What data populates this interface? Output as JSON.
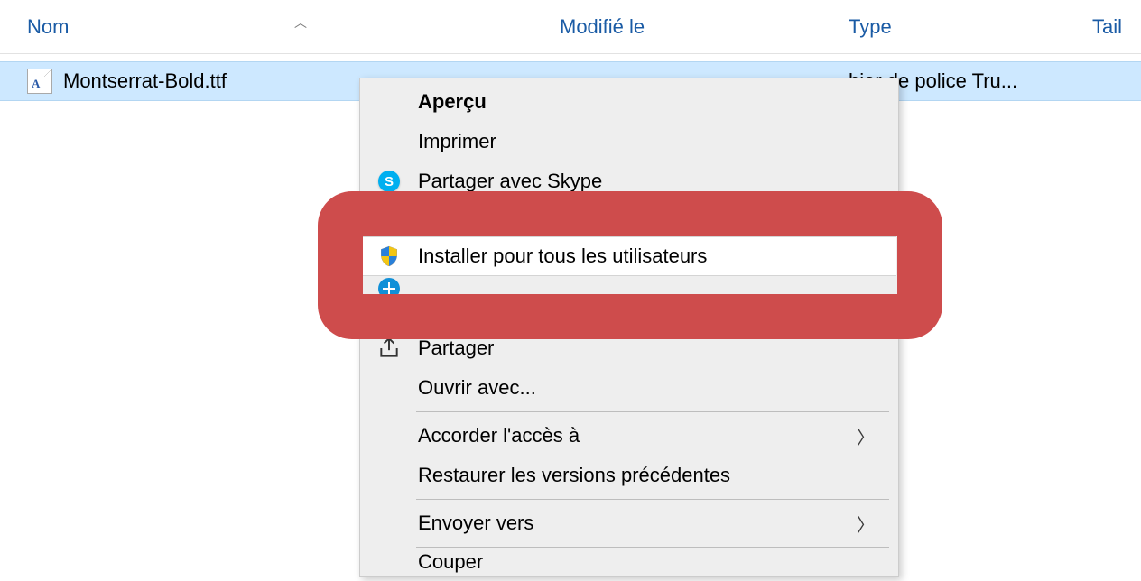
{
  "columns": {
    "name": "Nom",
    "modified": "Modifié le",
    "type": "Type",
    "size": "Tail"
  },
  "file": {
    "icon_letter": "A",
    "name": "Montserrat-Bold.ttf",
    "type_truncated": "hier de police Tru..."
  },
  "context_menu": {
    "preview": "Aperçu",
    "print": "Imprimer",
    "share_skype": "Partager avec Skype",
    "install_all": "Installer pour tous les utilisateurs",
    "share": "Partager",
    "open_with": "Ouvrir avec...",
    "grant_access": "Accorder l'accès à",
    "restore_versions": "Restaurer les versions précédentes",
    "send_to": "Envoyer vers",
    "cut": "Couper"
  },
  "icons": {
    "skype_letter": "S"
  }
}
